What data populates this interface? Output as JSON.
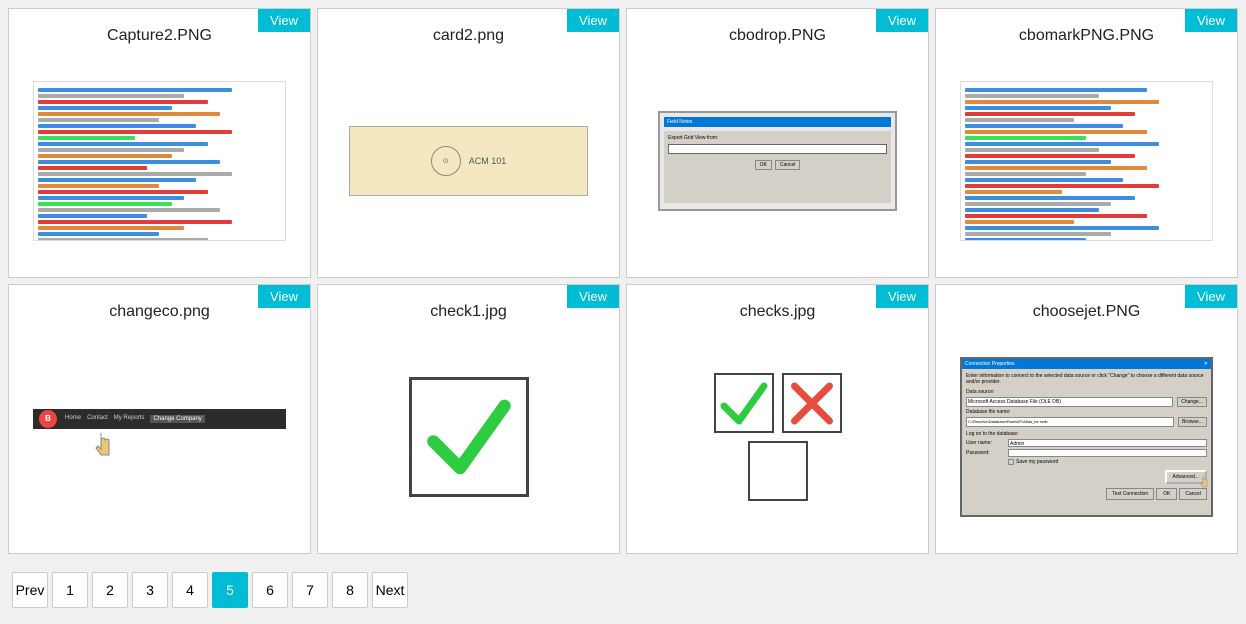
{
  "cards": [
    {
      "id": "card-1",
      "title": "Capture2.PNG",
      "view_label": "View",
      "type": "code"
    },
    {
      "id": "card-2",
      "title": "card2.png",
      "view_label": "View",
      "type": "card2"
    },
    {
      "id": "card-3",
      "title": "cbodrop.PNG",
      "view_label": "View",
      "type": "dialog"
    },
    {
      "id": "card-4",
      "title": "cbomarkPNG.PNG",
      "view_label": "View",
      "type": "code2"
    },
    {
      "id": "card-5",
      "title": "changeco.png",
      "view_label": "View",
      "type": "nav"
    },
    {
      "id": "card-6",
      "title": "check1.jpg",
      "view_label": "View",
      "type": "check1"
    },
    {
      "id": "card-7",
      "title": "checks.jpg",
      "view_label": "View",
      "type": "checks"
    },
    {
      "id": "card-8",
      "title": "choosejet.PNG",
      "view_label": "View",
      "type": "conn"
    }
  ],
  "pagination": {
    "prev_label": "Prev",
    "next_label": "Next",
    "pages": [
      "1",
      "2",
      "3",
      "4",
      "5",
      "6",
      "7",
      "8"
    ],
    "active_page": "5"
  }
}
